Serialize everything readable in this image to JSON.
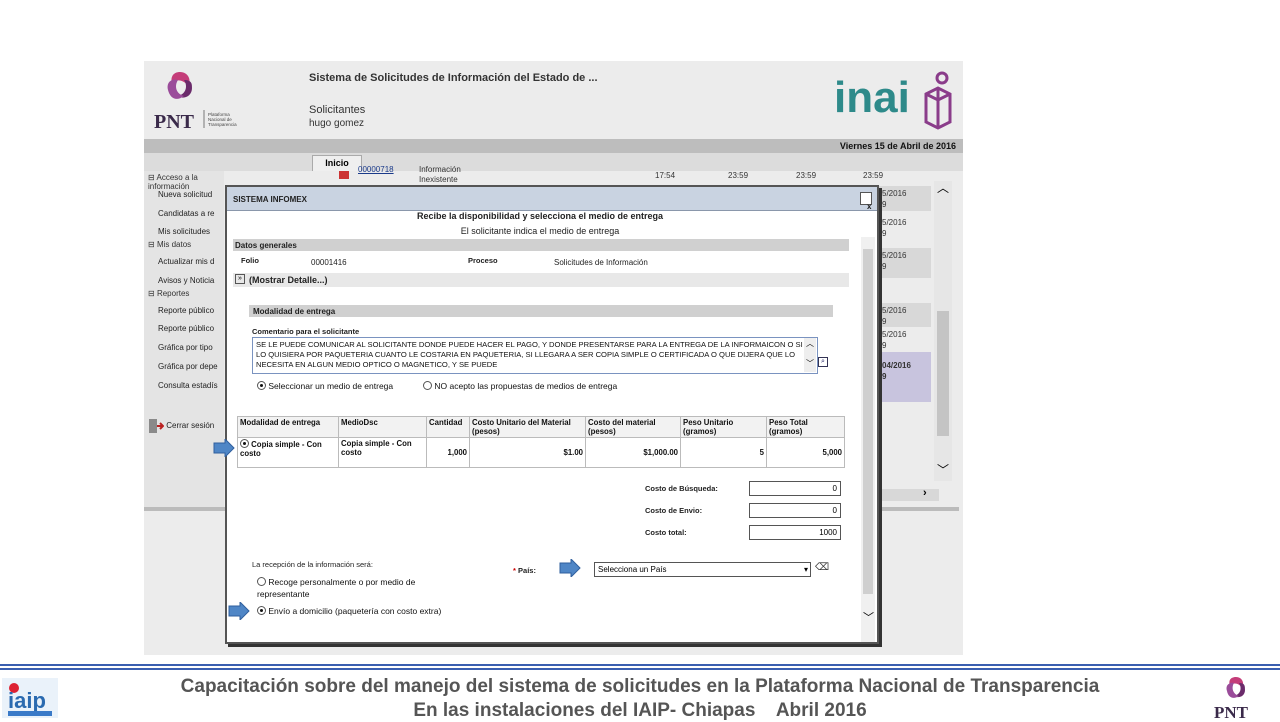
{
  "header": {
    "system_title": "Sistema de Solicitudes de Información del Estado de ...",
    "role": "Solicitantes",
    "user": "hugo gomez",
    "pnt_text": "PNT",
    "pnt_sub": "Plataforma Nacional de Transparencia",
    "inai_text": "inai",
    "date": "Viernes 15 de Abril de 2016",
    "tab": "Inicio"
  },
  "sidebar": {
    "sections": [
      {
        "label": "Acceso a la información",
        "items": [
          "Nueva solicitud",
          "Candidatas a re",
          "Mis solicitudes"
        ]
      },
      {
        "label": "Mis datos",
        "items": [
          "Actualizar mis d",
          "Avisos y Noticia"
        ]
      },
      {
        "label": "Reportes",
        "items": [
          "Reporte público",
          "Reporte público",
          "Gráfica por tipo",
          "Gráfica por depe",
          "Consulta estadís"
        ]
      }
    ],
    "logout": "Cerrar sesión"
  },
  "background": {
    "row_id": "00000718",
    "row_text1": "Información",
    "row_text2": "Inexistente",
    "times": [
      "17:54",
      "23:59",
      "23:59",
      "23:59"
    ],
    "right_dates": [
      "5/2016",
      "5/2016",
      "5/2016",
      "5/2016",
      "5/2016",
      "04/2016"
    ],
    "right_suffix": "9"
  },
  "dialog": {
    "title": "SISTEMA INFOMEX",
    "heading": "Recibe la disponibilidad y selecciona el medio de entrega",
    "subheading": "El solicitante indica el medio de entrega",
    "general_label": "Datos generales",
    "folio_label": "Folio",
    "folio_value": "00001416",
    "proceso_label": "Proceso",
    "proceso_value": "Solicitudes de Información",
    "toggle": "(Mostrar Detalle...)",
    "modalidad_header": "Modalidad de entrega",
    "comment_label": "Comentario para el solicitante",
    "comment_text": "SE LE PUEDE COMUNICAR AL SOLICITANTE DONDE PUEDE HACER EL PAGO, Y DONDE PRESENTARSE PARA LA ENTREGA DE LA INFORMAICON O SI LO QUISIERA POR PAQUETERIA CUANTO LE COSTARIA EN PAQUETERIA, SI LLEGARA A SER COPIA SIMPLE O CERTIFICADA O QUE DIJERA QUE LO NECESITA EN ALGUN MEDIO OPTICO O MAGNETICO, Y SE PUEDE",
    "radio_select": "Seleccionar un medio de entrega",
    "radio_reject": "NO acepto las propuestas de medios de entrega",
    "table": {
      "headers": [
        "Modalidad de entrega",
        "MedioDsc",
        "Cantidad",
        "Costo Unitario del Material (pesos)",
        "Costo del material (pesos)",
        "Peso Unitario (gramos)",
        "Peso Total (gramos)"
      ],
      "row": [
        "Copia simple - Con costo",
        "Copia simple - Con costo",
        "1,000",
        "$1.00",
        "$1,000.00",
        "5",
        "5,000"
      ]
    },
    "costo_busqueda_label": "Costo de Búsqueda:",
    "costo_busqueda": "0",
    "costo_envio_label": "Costo de Envio:",
    "costo_envio": "0",
    "costo_total_label": "Costo total:",
    "costo_total": "1000",
    "recepcion_label": "La recepción de la información será:",
    "opt_personal": "Recoge personalmente o por medio de representante",
    "opt_domicilio": "Envío a domicilio (paquetería con costo extra)",
    "pais_label": "País:",
    "pais_value": "Selecciona un País"
  },
  "footer": {
    "line1": "Capacitación sobre del manejo del sistema de solicitudes en la Plataforma Nacional de Transparencia",
    "line2": "En las instalaciones del IAIP- Chiapas    Abril 2016",
    "iaip_text": "iaip",
    "pnt_text": "PNT"
  },
  "colors": {
    "accent_purple": "#6b2b6b",
    "inai_teal": "#2e8a8a",
    "inai_purple": "#8a3c8a",
    "arrow_blue": "#4f86c6",
    "footer_rule": "#3a5fb0"
  }
}
